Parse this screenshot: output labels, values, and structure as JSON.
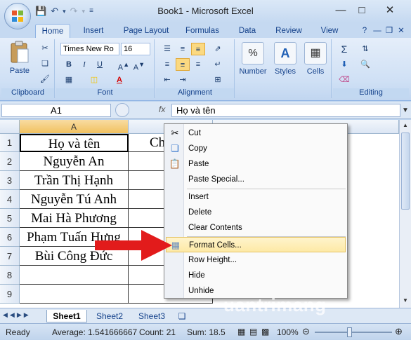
{
  "window": {
    "title": "Book1 - Microsoft Excel"
  },
  "qat": {
    "save_icon": "save-icon",
    "undo_icon": "undo-icon",
    "redo_icon": "redo-icon"
  },
  "tabs": [
    "Home",
    "Insert",
    "Page Layout",
    "Formulas",
    "Data",
    "Review",
    "View"
  ],
  "ribbon": {
    "clipboard": {
      "paste": "Paste",
      "label": "Clipboard"
    },
    "font": {
      "name": "Times New Ro",
      "size": "16",
      "bold": "B",
      "italic": "I",
      "underline": "U",
      "label": "Font"
    },
    "alignment": {
      "label": "Alignment"
    },
    "number": {
      "button": "Number",
      "symbol": "%"
    },
    "styles": {
      "button": "Styles"
    },
    "cells": {
      "button": "Cells"
    },
    "editing": {
      "sum": "Σ",
      "label": "Editing"
    }
  },
  "formula_bar": {
    "name_box": "A1",
    "fx": "fx",
    "content": "Họ và tên"
  },
  "columns": [
    "A"
  ],
  "rows": [
    "1",
    "2",
    "3",
    "4",
    "5",
    "6",
    "7",
    "8",
    "9"
  ],
  "cells": {
    "col_a": [
      "Họ và tên",
      "Nguyễn An",
      "Trần Thị Hạnh",
      "Nguyễn Tú Anh",
      "Mai Hà Phương",
      "Phạm Tuấn Hưng",
      "Bùi Công Đức",
      "",
      ""
    ],
    "b1": "Ch"
  },
  "context_menu": {
    "items": [
      "Cut",
      "Copy",
      "Paste",
      "Paste Special...",
      "Insert",
      "Delete",
      "Clear Contents",
      "Format Cells...",
      "Row Height...",
      "Hide",
      "Unhide"
    ],
    "highlighted": "Format Cells..."
  },
  "sheet_tabs": [
    "Sheet1",
    "Sheet2",
    "Sheet3"
  ],
  "status": {
    "mode": "Ready",
    "average": "Average: 1.541666667",
    "count": "Count: 21",
    "sum": "Sum: 18.5",
    "zoom": "100%"
  },
  "watermark": "uantrimang",
  "colors": {
    "accent": "#15428b",
    "arrow": "#e21b1b",
    "highlight": "#fde9a6"
  }
}
